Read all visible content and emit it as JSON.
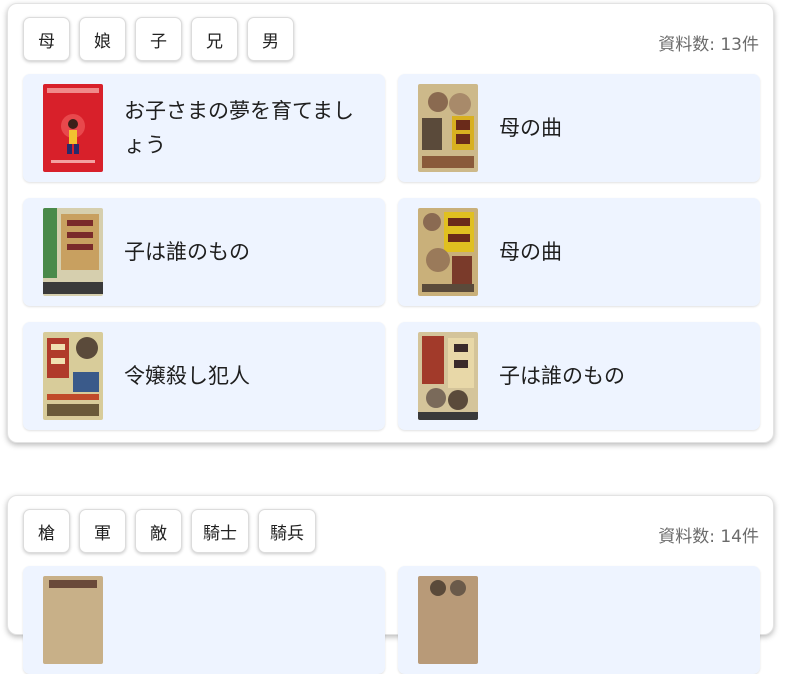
{
  "groups": [
    {
      "tags": [
        "母",
        "娘",
        "子",
        "兄",
        "男"
      ],
      "count_label": "資料数: 13件",
      "items": [
        {
          "title": "お子さまの夢を育てましょう",
          "thumb": "red-poster-thumbnail"
        },
        {
          "title": "母の曲",
          "thumb": "film-poster-thumbnail"
        },
        {
          "title": "子は誰のもの",
          "thumb": "film-poster-thumbnail"
        },
        {
          "title": "母の曲",
          "thumb": "film-poster-thumbnail"
        },
        {
          "title": "令嬢殺し犯人",
          "thumb": "film-poster-thumbnail"
        },
        {
          "title": "子は誰のもの",
          "thumb": "film-poster-thumbnail"
        }
      ]
    },
    {
      "tags": [
        "槍",
        "軍",
        "敵",
        "騎士",
        "騎兵"
      ],
      "count_label": "資料数: 14件"
    }
  ]
}
